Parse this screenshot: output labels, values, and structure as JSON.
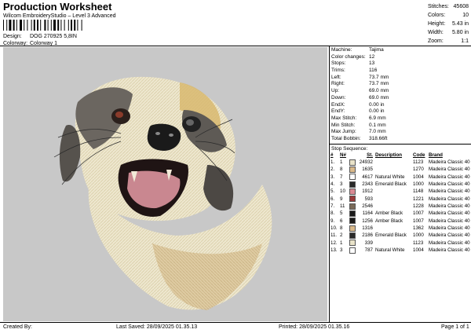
{
  "header": {
    "title": "Production Worksheet",
    "subtitle": "Wilcom EmbroideryStudio – Level 3 Advanced",
    "design_label": "Design:",
    "design_value": "DOG 270925 5,8IN",
    "colorway_label": "Colorway:",
    "colorway_value": "Colorway 1"
  },
  "stats": [
    {
      "label": "Stitches:",
      "value": "45608"
    },
    {
      "label": "Colors:",
      "value": "10"
    },
    {
      "label": "Height:",
      "value": "5.43 in"
    },
    {
      "label": "Width:",
      "value": "5.80 in"
    },
    {
      "label": "Zoom:",
      "value": "1:1"
    }
  ],
  "machine_info": [
    {
      "label": "Machine:",
      "value": "Tajima"
    },
    {
      "label": "Color changes:",
      "value": "12"
    },
    {
      "label": "Stops:",
      "value": "13"
    },
    {
      "label": "Trims:",
      "value": "116"
    },
    {
      "label": "Left:",
      "value": "73.7 mm"
    },
    {
      "label": "Right:",
      "value": "73.7 mm"
    },
    {
      "label": "Up:",
      "value": "69.0 mm"
    },
    {
      "label": "Down:",
      "value": "69.0 mm"
    },
    {
      "label": "EndX:",
      "value": "0.00 in"
    },
    {
      "label": "EndY:",
      "value": "0.00 in"
    },
    {
      "label": "Max Stitch:",
      "value": "6.9 mm"
    },
    {
      "label": "Min Stitch:",
      "value": "0.1 mm"
    },
    {
      "label": "Max Jump:",
      "value": "7.0 mm"
    },
    {
      "label": "Total Bobbin:",
      "value": "318.66ft"
    }
  ],
  "stop_sequence": {
    "title": "Stop Sequence:",
    "headers": [
      "#",
      "N#",
      "",
      "St.",
      "Description",
      "Code",
      "Brand"
    ],
    "rows": [
      {
        "n": "1.",
        "needle": "1",
        "color": "#e9e3c9",
        "st": "24932",
        "desc": "",
        "code": "1123",
        "brand": "Madeira Classic 40"
      },
      {
        "n": "2.",
        "needle": "8",
        "color": "#d9b98a",
        "st": "1635",
        "desc": "",
        "code": "1270",
        "brand": "Madeira Classic 40"
      },
      {
        "n": "3.",
        "needle": "7",
        "color": "#ffffff",
        "st": "4617",
        "desc": "Natural White",
        "code": "1004",
        "brand": "Madeira Classic 40"
      },
      {
        "n": "4.",
        "needle": "3",
        "color": "#2a2a2a",
        "st": "2343",
        "desc": "Emerald Black",
        "code": "1000",
        "brand": "Madeira Classic 40"
      },
      {
        "n": "5.",
        "needle": "10",
        "color": "#d98a94",
        "st": "1912",
        "desc": "",
        "code": "1148",
        "brand": "Madeira Classic 40"
      },
      {
        "n": "6.",
        "needle": "9",
        "color": "#9a3a3a",
        "st": "593",
        "desc": "",
        "code": "1221",
        "brand": "Madeira Classic 40"
      },
      {
        "n": "7.",
        "needle": "11",
        "color": "#7a6a58",
        "st": "2546",
        "desc": "",
        "code": "1228",
        "brand": "Madeira Classic 40"
      },
      {
        "n": "8.",
        "needle": "5",
        "color": "#1a1a1a",
        "st": "1164",
        "desc": "Amber Black",
        "code": "1007",
        "brand": "Madeira Classic 40"
      },
      {
        "n": "9.",
        "needle": "6",
        "color": "#1a1a1a",
        "st": "1256",
        "desc": "Amber Black",
        "code": "1007",
        "brand": "Madeira Classic 40"
      },
      {
        "n": "10.",
        "needle": "8",
        "color": "#d9b98a",
        "st": "1316",
        "desc": "",
        "code": "1362",
        "brand": "Madeira Classic 40"
      },
      {
        "n": "11.",
        "needle": "2",
        "color": "#2a2a2a",
        "st": "2186",
        "desc": "Emerald Black",
        "code": "1000",
        "brand": "Madeira Classic 40"
      },
      {
        "n": "12.",
        "needle": "1",
        "color": "#e9e3c9",
        "st": "339",
        "desc": "",
        "code": "1123",
        "brand": "Madeira Classic 40"
      },
      {
        "n": "13.",
        "needle": "3",
        "color": "#ffffff",
        "st": "787",
        "desc": "Natural White",
        "code": "1004",
        "brand": "Madeira Classic 40"
      }
    ]
  },
  "footer": {
    "created": "Created By:",
    "saved": "Last Saved: 28/09/2025 01.35.13",
    "printed": "Printed: 28/09/2025 01.35.16",
    "page": "Page 1 of 1"
  },
  "canvas": {
    "background": "#c8c8c8"
  }
}
